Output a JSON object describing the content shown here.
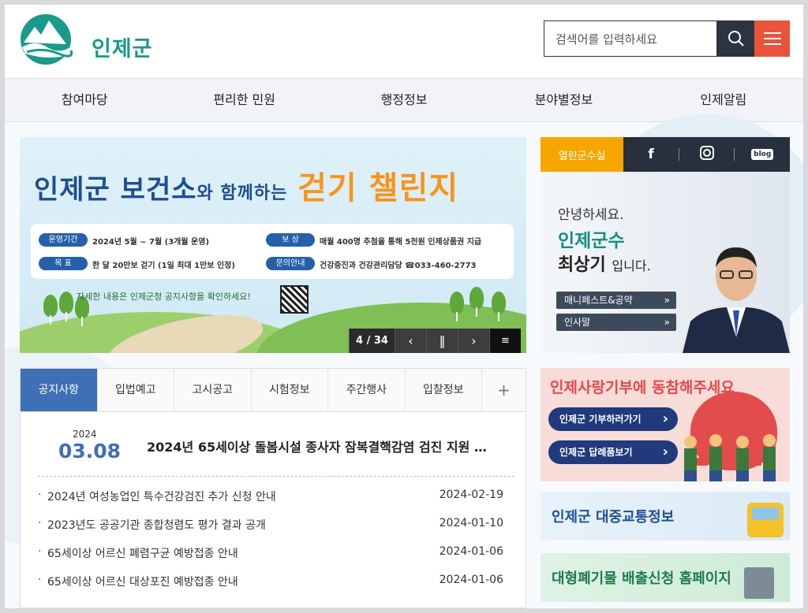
{
  "header": {
    "logo_text": "인제군",
    "search_placeholder": "검색어를 입력하세요",
    "icons": [
      "search-icon",
      "hamburger-menu-icon"
    ],
    "brand_color": "#1a9a8a",
    "menu_button_color": "#e8533a"
  },
  "nav": {
    "items": [
      "참여마당",
      "편리한 민원",
      "행정정보",
      "분야별정보",
      "인제알림"
    ]
  },
  "banner": {
    "title_part1": "인제군 보건소",
    "title_small": "와 함께하는",
    "title_highlight": "걷기 챌린지",
    "info": [
      {
        "label": "운영기간",
        "value": "2024년 5월 ~ 7월 (3개월 운영)"
      },
      {
        "label": "보    상",
        "value": "매월 400명 추첨을 통해 5천원 인제상품권 지급"
      },
      {
        "label": "목    표",
        "value": "한 달 20만보 걷기 (1일 최대 1만보 인정)"
      },
      {
        "label": "문의안내",
        "value": "건강증진과 건강관리담당 ☎033-460-2773"
      }
    ],
    "note": "자세한 내용은 인제군청 공지사항을 확인하세요!",
    "slide_current": "4",
    "slide_total": "34",
    "slide_counter": "4 / 34"
  },
  "sns": {
    "tab_label": "열린군수실",
    "icons": [
      "facebook-icon",
      "instagram-icon",
      "blog-icon"
    ],
    "facebook_glyph": "f",
    "blog_glyph": "blog"
  },
  "mayor": {
    "greeting": "안녕하세요.",
    "title": "인제군수",
    "name": "최상기",
    "suffix": "입니다.",
    "buttons": [
      "매니페스트&공약",
      "인사말"
    ]
  },
  "board": {
    "tabs": [
      "공지사항",
      "입법예고",
      "고시공고",
      "시험정보",
      "주간행사",
      "입찰정보"
    ],
    "active_tab": "공지사항",
    "more_label": "+",
    "featured": {
      "year": "2024",
      "date": "03.08",
      "title": "2024년 65세이상 돌봄시설 종사자 잠복결핵감염 검진 지원 …"
    },
    "items": [
      {
        "title": "2024년 여성농업인 특수건강검진 추가 신청 안내",
        "date": "2024-02-19"
      },
      {
        "title": "2023년도 공공기관 종합청렴도 평가 결과 공개",
        "date": "2024-01-10"
      },
      {
        "title": "65세이상 어르신 폐렴구균 예방접종 안내",
        "date": "2024-01-06"
      },
      {
        "title": "65세이상 어르신 대상포진 예방접종 안내",
        "date": "2024-01-06"
      }
    ]
  },
  "donate": {
    "title": "인제사랑기부에 동참해주세요",
    "buttons": [
      "인제군 기부하러가기",
      "인제군 답례품보기"
    ]
  },
  "transit": {
    "label": "인제군 대중교통정보"
  },
  "waste": {
    "label": "대형폐기물 배출신청 홈페이지"
  }
}
